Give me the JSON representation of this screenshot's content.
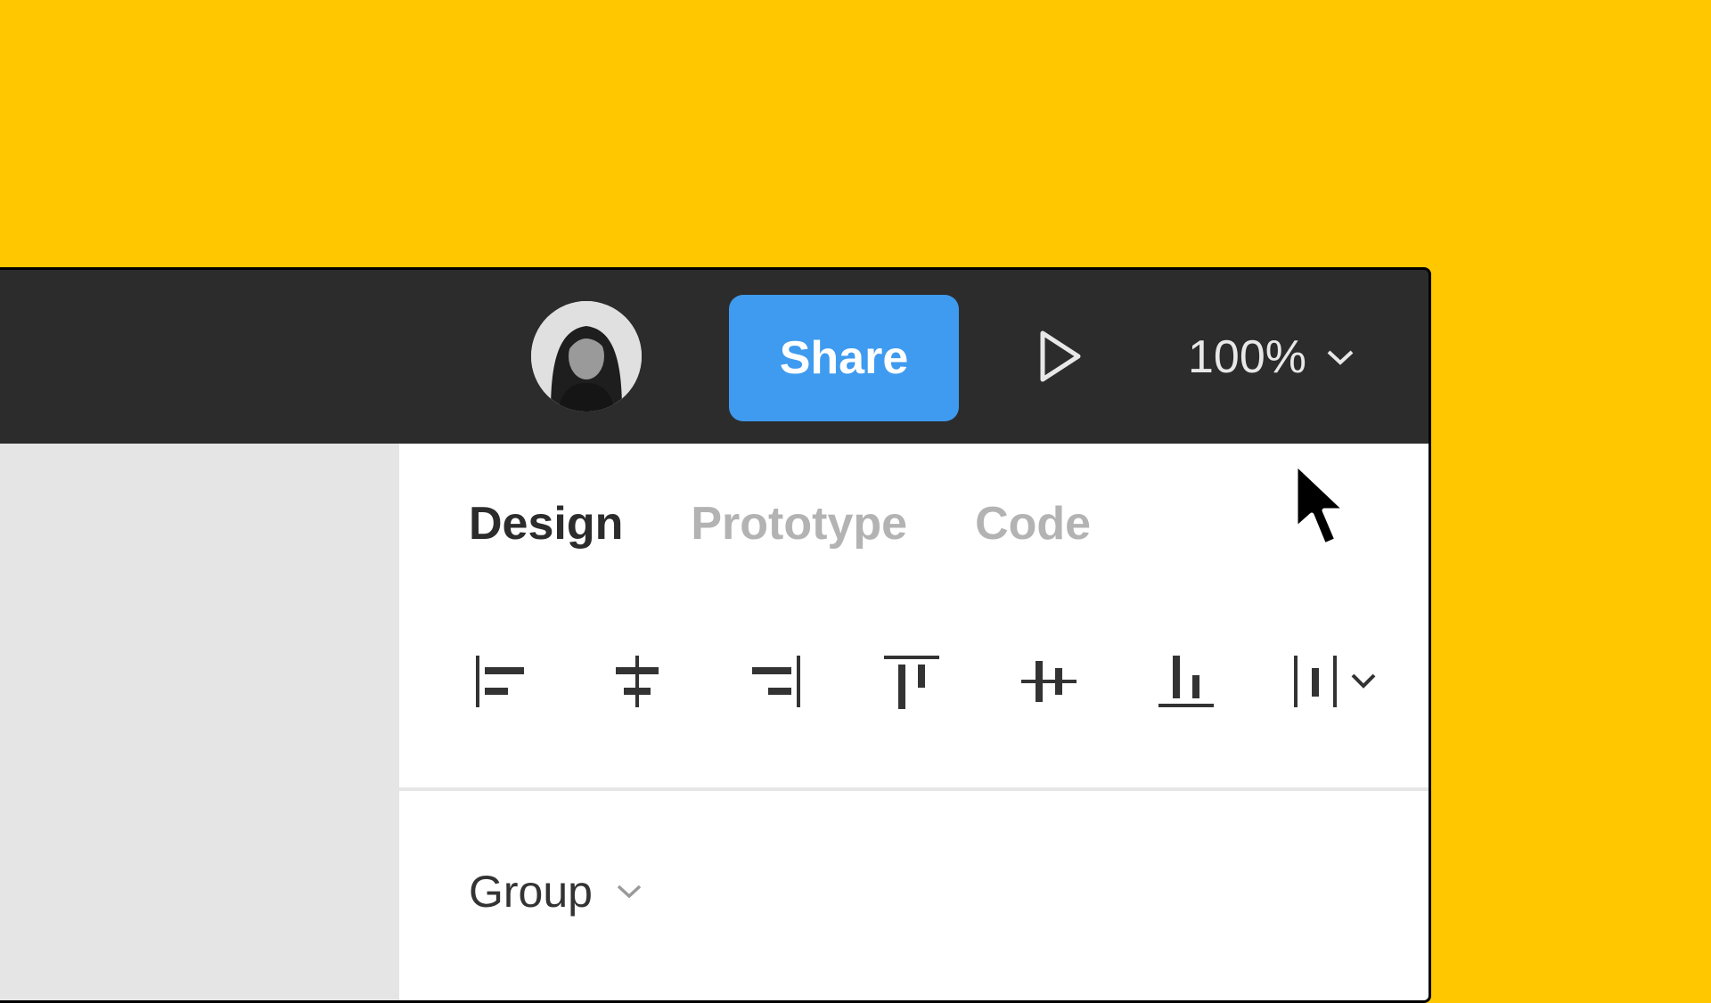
{
  "toolbar": {
    "avatar_alt": "User avatar",
    "share_label": "Share",
    "play_icon": "play-icon",
    "zoom_value": "100%",
    "zoom_icon": "chevron-down-icon"
  },
  "panel": {
    "tabs": [
      {
        "label": "Design",
        "active": true
      },
      {
        "label": "Prototype",
        "active": false
      },
      {
        "label": "Code",
        "active": false
      }
    ],
    "align_tools": [
      {
        "name": "align-left",
        "icon": "align-left-icon"
      },
      {
        "name": "align-horizontal-center",
        "icon": "align-horizontal-center-icon"
      },
      {
        "name": "align-right",
        "icon": "align-right-icon"
      },
      {
        "name": "align-top",
        "icon": "align-top-icon"
      },
      {
        "name": "align-vertical-center",
        "icon": "align-vertical-center-icon"
      },
      {
        "name": "align-bottom",
        "icon": "align-bottom-icon"
      },
      {
        "name": "distribute",
        "icon": "distribute-spacing-icon"
      }
    ],
    "group_label": "Group"
  },
  "colors": {
    "background": "#FFC700",
    "toolbar": "#2C2C2C",
    "share": "#3E9BEF",
    "canvas": "#E5E5E5",
    "panel": "#FFFFFF"
  }
}
